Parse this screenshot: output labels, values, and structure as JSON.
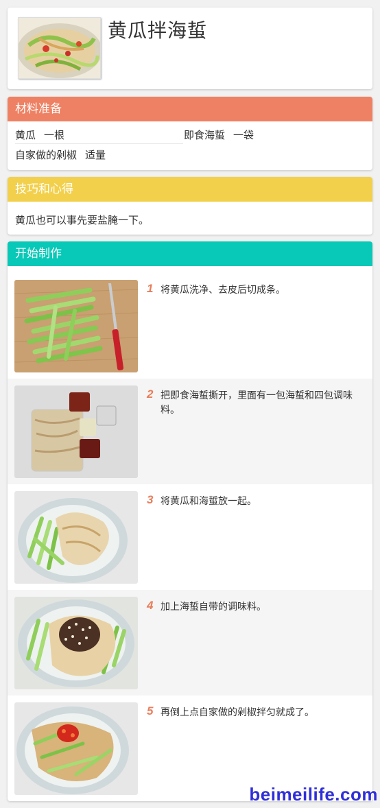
{
  "recipe": {
    "title": "黄瓜拌海蜇"
  },
  "ingredients": {
    "header": "材料准备",
    "items": [
      {
        "name": "黄瓜",
        "amount": "一根"
      },
      {
        "name": "即食海蜇",
        "amount": "一袋"
      },
      {
        "name": "自家做的剁椒",
        "amount": "适量"
      }
    ]
  },
  "tips": {
    "header": "技巧和心得",
    "text": "黄瓜也可以事先要盐腌一下。"
  },
  "steps": {
    "header": "开始制作",
    "items": [
      {
        "num": "1",
        "text": "将黄瓜洗净、去皮后切成条。"
      },
      {
        "num": "2",
        "text": "把即食海蜇撕开，里面有一包海蜇和四包调味料。"
      },
      {
        "num": "3",
        "text": "将黄瓜和海蜇放一起。"
      },
      {
        "num": "4",
        "text": "加上海蜇自带的调味料。"
      },
      {
        "num": "5",
        "text": "再倒上点自家做的剁椒拌匀就成了。"
      }
    ]
  },
  "watermark": "beimeilife.com",
  "colors": {
    "ingredients": "#ee8163",
    "tips": "#f2d04c",
    "steps": "#08c8b7",
    "step_num": "#e87e5b"
  }
}
